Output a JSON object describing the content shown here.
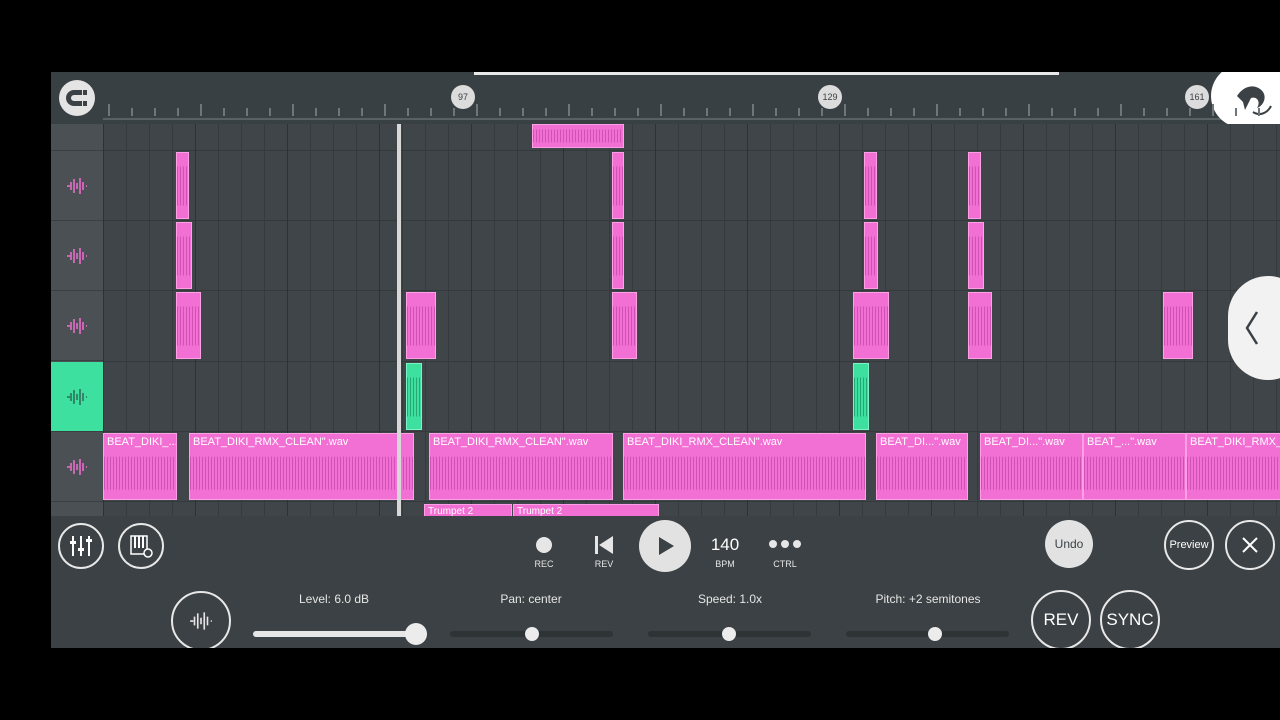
{
  "ruler": {
    "markers": [
      "97",
      "129",
      "161"
    ]
  },
  "tracks": {
    "clips": [
      {
        "label": "BEAT_DIKI_..."
      },
      {
        "label": "BEAT_DIKI_RMX_CLEAN\".wav"
      },
      {
        "label": "BEAT_DIKI_RMX_CLEAN\".wav"
      },
      {
        "label": "BEAT_DIKI_RMX_CLEAN\".wav"
      },
      {
        "label": "BEAT_DI...\".wav"
      },
      {
        "label": "BEAT_DI...\".wav"
      },
      {
        "label": "BEAT_...\".wav"
      },
      {
        "label": "BEAT_DIKI_RMX_C"
      }
    ],
    "bottom_clips": [
      "Trumpet 2",
      "Trumpet 2"
    ]
  },
  "transport": {
    "rec_label": "REC",
    "rev_label": "REV",
    "bpm_value": "140",
    "bpm_label": "BPM",
    "ctrl_label": "CTRL"
  },
  "buttons": {
    "undo": "Undo",
    "preview": "Preview",
    "rev": "REV",
    "sync": "SYNC"
  },
  "params": {
    "level": {
      "label": "Level: 6.0 dB",
      "value_fraction": 1.0
    },
    "pan": {
      "label": "Pan: center",
      "value_fraction": 0.5
    },
    "speed": {
      "label": "Speed: 1.0x",
      "value_fraction": 0.5
    },
    "pitch": {
      "label": "Pitch: +2 semitones",
      "value_fraction": 0.55
    }
  },
  "colors": {
    "clip_pink": "#f26fd4",
    "clip_green": "#3ee0a0",
    "background": "#3b4144"
  },
  "icons": [
    "magnet-snap-icon",
    "fl-studio-logo-icon",
    "waveform-icon",
    "chevron-left-icon",
    "mixer-icon",
    "piano-settings-icon",
    "record-icon",
    "rewind-icon",
    "play-icon",
    "more-dots-icon",
    "close-icon"
  ]
}
